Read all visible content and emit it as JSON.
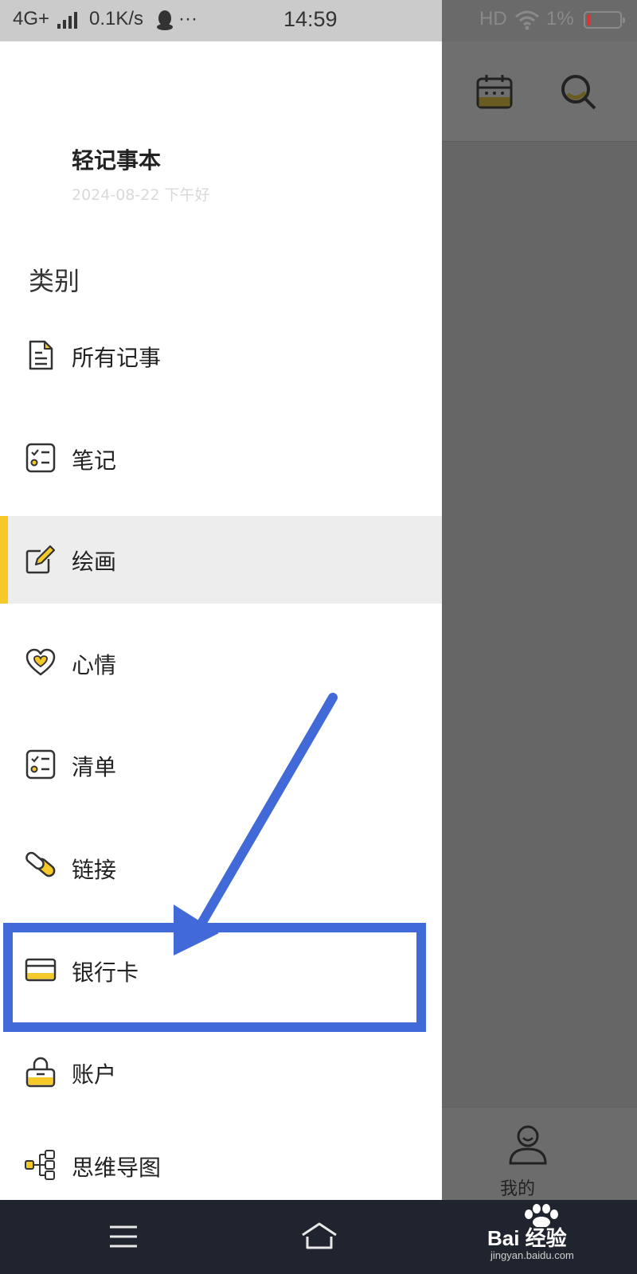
{
  "status_bar": {
    "network": "4G+",
    "speed": "0.1K/s",
    "more": "···",
    "time": "14:59",
    "hd": "HD",
    "battery": "1%"
  },
  "drawer": {
    "app_title": "轻记事本",
    "date_greeting": "2024-08-22 下午好",
    "section_title": "类别",
    "items": [
      {
        "label": "所有记事",
        "icon": "document-icon"
      },
      {
        "label": "笔记",
        "icon": "checklist-icon"
      },
      {
        "label": "绘画",
        "icon": "pencil-edit-icon",
        "active": true
      },
      {
        "label": "心情",
        "icon": "heart-icon"
      },
      {
        "label": "清单",
        "icon": "checklist-icon"
      },
      {
        "label": "链接",
        "icon": "link-icon"
      },
      {
        "label": "银行卡",
        "icon": "credit-card-icon"
      },
      {
        "label": "账户",
        "icon": "lock-icon"
      },
      {
        "label": "思维导图",
        "icon": "mindmap-icon"
      }
    ]
  },
  "main": {
    "profile_label": "我的"
  },
  "watermark": {
    "brand": "Bai 经验",
    "url": "jingyan.baidu.com"
  },
  "colors": {
    "accent": "#f6c92b",
    "annotation": "#4169d8",
    "navbar": "#20242e"
  }
}
